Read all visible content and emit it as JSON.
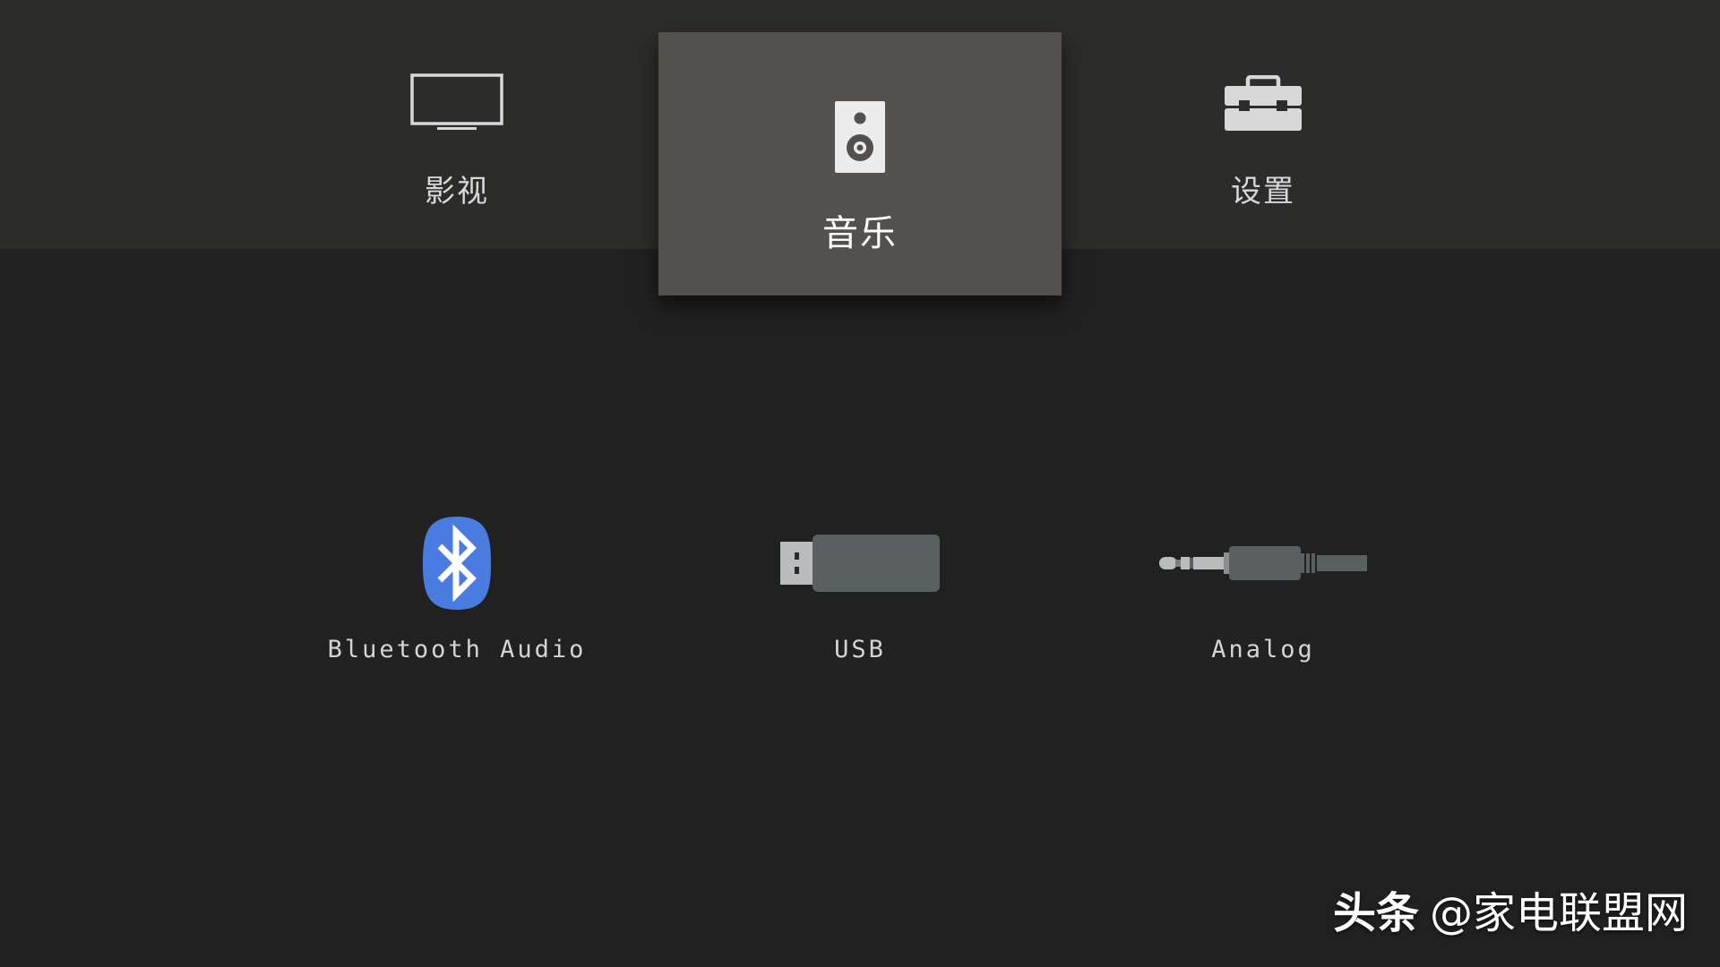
{
  "nav": {
    "tabs": [
      {
        "label": "影视",
        "icon": "tv-icon"
      },
      {
        "label": "音乐",
        "icon": "speaker-icon",
        "selected": true
      },
      {
        "label": "设置",
        "icon": "toolbox-icon"
      }
    ]
  },
  "sources": [
    {
      "label": "Bluetooth Audio",
      "icon": "bluetooth-icon"
    },
    {
      "label": "USB",
      "icon": "usb-drive-icon"
    },
    {
      "label": "Analog",
      "icon": "audio-jack-icon"
    }
  ],
  "watermark": {
    "brand": "头条",
    "handle": "@家电联盟网"
  },
  "colors": {
    "background": "#212121",
    "top_bar": "#2c2c2a",
    "selected_tab": "#54504d",
    "bluetooth_blue": "#4a7be0",
    "icon_gray": "#5a6062"
  }
}
